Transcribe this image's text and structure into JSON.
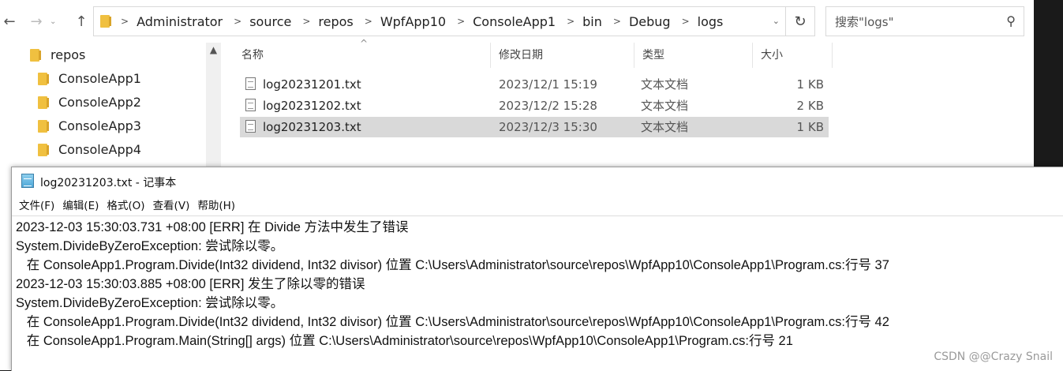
{
  "explorer": {
    "nav": {
      "back": "←",
      "forward": "→",
      "up": "↑"
    },
    "breadcrumb": [
      "Administrator",
      "source",
      "repos",
      "WpfApp10",
      "ConsoleApp1",
      "bin",
      "Debug",
      "logs"
    ],
    "refresh_glyph": "↻",
    "search": {
      "placeholder": "搜索\"logs\"",
      "icon": "⚲"
    },
    "nav_pane": {
      "scroll_up_glyph": "▲",
      "items": [
        {
          "label": "repos"
        },
        {
          "label": "ConsoleApp1"
        },
        {
          "label": "ConsoleApp2"
        },
        {
          "label": "ConsoleApp3"
        },
        {
          "label": "ConsoleApp4"
        }
      ]
    },
    "columns": {
      "name": "名称",
      "date": "修改日期",
      "type": "类型",
      "size": "大小",
      "sort_glyph": "^"
    },
    "files": [
      {
        "name": "log20231201.txt",
        "date": "2023/12/1 15:19",
        "type": "文本文档",
        "size": "1 KB"
      },
      {
        "name": "log20231202.txt",
        "date": "2023/12/2 15:28",
        "type": "文本文档",
        "size": "2 KB"
      },
      {
        "name": "log20231203.txt",
        "date": "2023/12/3 15:30",
        "type": "文本文档",
        "size": "1 KB",
        "selected": true
      }
    ]
  },
  "notepad": {
    "title": "log20231203.txt - 记事本",
    "menu": [
      {
        "label": "文件(F)"
      },
      {
        "label": "编辑(E)"
      },
      {
        "label": "格式(O)"
      },
      {
        "label": "查看(V)"
      },
      {
        "label": "帮助(H)"
      }
    ],
    "lines": [
      "2023-12-03 15:30:03.731 +08:00 [ERR] 在 Divide 方法中发生了错误",
      "System.DivideByZeroException: 尝试除以零。",
      "   在 ConsoleApp1.Program.Divide(Int32 dividend, Int32 divisor) 位置 C:\\Users\\Administrator\\source\\repos\\WpfApp10\\ConsoleApp1\\Program.cs:行号 37",
      "2023-12-03 15:30:03.885 +08:00 [ERR] 发生了除以零的错误",
      "System.DivideByZeroException: 尝试除以零。",
      "   在 ConsoleApp1.Program.Divide(Int32 dividend, Int32 divisor) 位置 C:\\Users\\Administrator\\source\\repos\\WpfApp10\\ConsoleApp1\\Program.cs:行号 42",
      "   在 ConsoleApp1.Program.Main(String[] args) 位置 C:\\Users\\Administrator\\source\\repos\\WpfApp10\\ConsoleApp1\\Program.cs:行号 21"
    ]
  },
  "watermark": "CSDN @@Crazy Snail"
}
